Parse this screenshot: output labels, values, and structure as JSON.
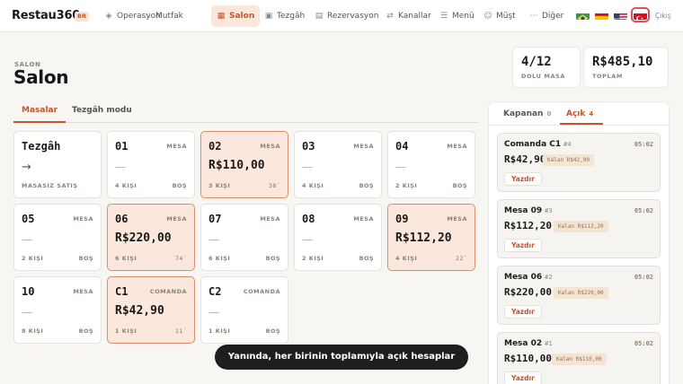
{
  "brand": {
    "name": "Restau360",
    "badge": "BR"
  },
  "nav": {
    "items": [
      {
        "icon": "diamond-icon",
        "glyph": "◈",
        "label": "Operasyon"
      },
      {
        "icon": "flame-icon",
        "glyph": "♨",
        "label": "Mutfak"
      },
      {
        "icon": "grid-icon",
        "glyph": "▦",
        "label": "Salon"
      },
      {
        "icon": "register-icon",
        "glyph": "▣",
        "label": "Tezgâh"
      },
      {
        "icon": "calendar-icon",
        "glyph": "▤",
        "label": "Rezervasyon"
      },
      {
        "icon": "arrows-icon",
        "glyph": "⇄",
        "label": "Kanallar"
      },
      {
        "icon": "menu-icon",
        "glyph": "☰",
        "label": "Menü"
      },
      {
        "icon": "smiley-icon",
        "glyph": "☺",
        "label": "Müşt"
      },
      {
        "icon": "more-icon",
        "glyph": "⋯",
        "label": "Diğer"
      }
    ],
    "active": "Salon",
    "logout": "Çıkış"
  },
  "header": {
    "eyebrow": "SALON",
    "title": "Salon"
  },
  "stats": [
    {
      "value": "4/12",
      "label": "DOLU MASA"
    },
    {
      "value": "R$485,10",
      "label": "TOPLAM"
    }
  ],
  "tabs": [
    {
      "label": "Masalar",
      "active": true
    },
    {
      "label": "Tezgâh modu",
      "active": false
    }
  ],
  "tables": [
    {
      "name": "Tezgâh",
      "kind": "",
      "center": "→",
      "left": "MASASIZ SATIŞ",
      "right": "",
      "occupied": false
    },
    {
      "name": "01",
      "kind": "MESA",
      "center": "—",
      "left": "4 KIŞI",
      "right": "BOŞ",
      "occupied": false
    },
    {
      "name": "02",
      "kind": "MESA",
      "center": "R$110,00",
      "left": "3 KIŞI",
      "right": "38´",
      "occupied": true
    },
    {
      "name": "03",
      "kind": "MESA",
      "center": "—",
      "left": "4 KIŞI",
      "right": "BOŞ",
      "occupied": false
    },
    {
      "name": "04",
      "kind": "MESA",
      "center": "—",
      "left": "2 KIŞI",
      "right": "BOŞ",
      "occupied": false
    },
    {
      "name": "05",
      "kind": "MESA",
      "center": "—",
      "left": "2 KIŞI",
      "right": "BOŞ",
      "occupied": false
    },
    {
      "name": "06",
      "kind": "MESA",
      "center": "R$220,00",
      "left": "6 KIŞI",
      "right": "74´",
      "occupied": true
    },
    {
      "name": "07",
      "kind": "MESA",
      "center": "—",
      "left": "6 KIŞI",
      "right": "BOŞ",
      "occupied": false
    },
    {
      "name": "08",
      "kind": "MESA",
      "center": "—",
      "left": "2 KIŞI",
      "right": "BOŞ",
      "occupied": false
    },
    {
      "name": "09",
      "kind": "MESA",
      "center": "R$112,20",
      "left": "4 KIŞI",
      "right": "22´",
      "occupied": true
    },
    {
      "name": "10",
      "kind": "MESA",
      "center": "—",
      "left": "8 KIŞI",
      "right": "BOŞ",
      "occupied": false
    },
    {
      "name": "C1",
      "kind": "COMANDA",
      "center": "R$42,90",
      "left": "1 KIŞI",
      "right": "11´",
      "occupied": true
    },
    {
      "name": "C2",
      "kind": "COMANDA",
      "center": "—",
      "left": "1 KIŞI",
      "right": "BOŞ",
      "occupied": false
    }
  ],
  "panel": {
    "tabs": [
      {
        "label": "Kapanan",
        "count": "0",
        "active": false
      },
      {
        "label": "Açık",
        "count": "4",
        "active": true
      }
    ],
    "orders": [
      {
        "name": "Comanda C1",
        "num": "#4",
        "time": "05:02",
        "amount": "R$42,90",
        "remaining": "Kalan R$42,90",
        "print": "Yazdır"
      },
      {
        "name": "Mesa 09",
        "num": "#3",
        "time": "05:02",
        "amount": "R$112,20",
        "remaining": "Kalan R$112,20",
        "print": "Yazdır"
      },
      {
        "name": "Mesa 06",
        "num": "#2",
        "time": "05:02",
        "amount": "R$220,00",
        "remaining": "Kalan R$220,00",
        "print": "Yazdır"
      },
      {
        "name": "Mesa 02",
        "num": "#1",
        "time": "05:02",
        "amount": "R$110,00",
        "remaining": "Kalan R$110,00",
        "print": "Yazdır"
      }
    ]
  },
  "toast": "Yanında, her birinin toplamıyla açık hesaplar",
  "colors": {
    "accent": "#c5542c",
    "occupied_bg": "#fbe7dc",
    "occupied_border": "#d98d68"
  }
}
